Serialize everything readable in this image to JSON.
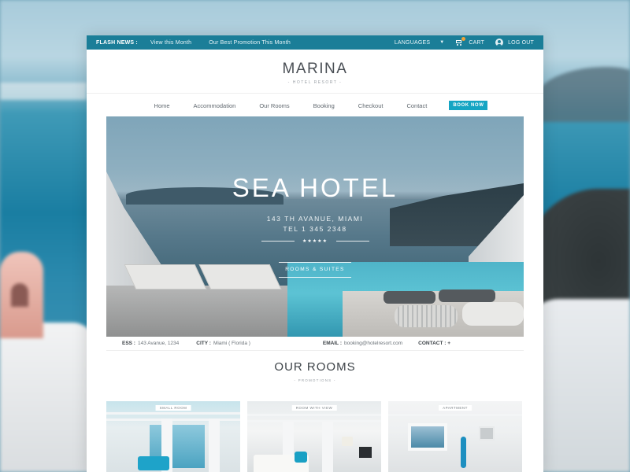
{
  "topbar": {
    "flash_label": "FLASH NEWS :",
    "links": [
      "View this Month",
      "Our Best Promotion This Month"
    ],
    "languages_label": "LANGUAGES",
    "cart_label": "CART",
    "logout_label": "LOG OUT",
    "color": "#1b7e98"
  },
  "logo": {
    "title": "MARINA",
    "subtitle": "- HOTEL RESORT -"
  },
  "nav": {
    "items": [
      "Home",
      "Accommodation",
      "Our Rooms",
      "Booking",
      "Checkout",
      "Contact"
    ],
    "book_label": "BOOK NOW",
    "accent": "#15a5c3"
  },
  "hero": {
    "title": "SEA HOTEL",
    "address": "143 TH AVANUE, MIAMI",
    "tel": "TEL 1 345 2348",
    "stars": "★★★★★",
    "button_label": "ROOMS & SUITES"
  },
  "info": {
    "address_label": "ESS :",
    "address_value": "143 Avanue, 1234",
    "city_label": "CITY :",
    "city_value": "Miami ( Florida )",
    "email_label": "EMAIL :",
    "email_value": "booking@hotelresort.com",
    "contact_label": "CONTACT : +"
  },
  "rooms": {
    "title": "OUR ROOMS",
    "subtitle": "- PROMOTIONS -",
    "cards": [
      {
        "tag": "SMALL ROOM"
      },
      {
        "tag": "ROOM WITH VIEW"
      },
      {
        "tag": "APARTMENT"
      }
    ]
  }
}
